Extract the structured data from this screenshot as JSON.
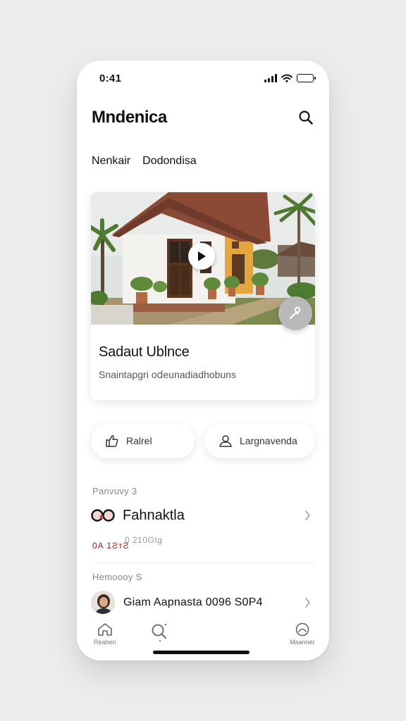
{
  "status_bar": {
    "time": "0:41"
  },
  "header": {
    "app_title": "Mndenica",
    "search_icon": "search-icon"
  },
  "tabs": [
    {
      "label": "Nenkair"
    },
    {
      "label": "Dodondisa"
    }
  ],
  "hero_card": {
    "title": "Sadaut Ublnce",
    "subtitle": "Snaintapgri o𝖽eunadiadhobuns",
    "play_icon": "play-icon",
    "fab_icon": "edit-person-icon"
  },
  "actions": [
    {
      "label": "Ralrel",
      "icon": "thumb-up-icon"
    },
    {
      "label": "Largnavenda",
      "icon": "user-icon"
    }
  ],
  "section1": {
    "label": "Panvuvy 3",
    "row_title": "Fahnaktla",
    "meta_red": "0A 1ƧᴛƧ",
    "meta_gray": "0 210Gtg"
  },
  "section2": {
    "label": "Hemoooy S",
    "row_title": "Giam Aapnasta 0096 S0P4"
  },
  "bottom_nav": [
    {
      "label": "Reaben",
      "icon": "home-icon"
    },
    {
      "label": "",
      "icon": "search-icon"
    },
    {
      "label": "Maanner",
      "icon": "profile-icon"
    }
  ],
  "colors": {
    "accent_red": "#8a1f1f",
    "fab_gray": "#b9b9b9",
    "wall_orange": "#e3a640"
  }
}
